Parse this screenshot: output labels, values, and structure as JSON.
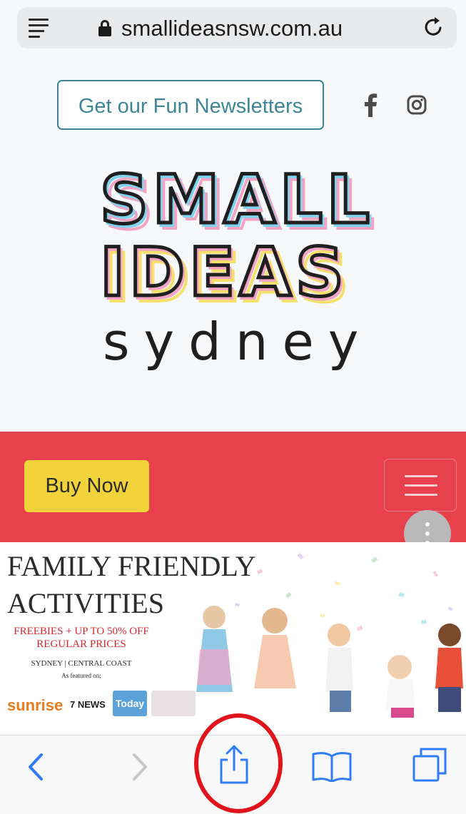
{
  "browser": {
    "url": "smallideasnsw.com.au",
    "icons": {
      "menu": "reader-icon",
      "lock": "lock-icon",
      "reload": "reload-icon"
    }
  },
  "header": {
    "newsletter_label": "Get our Fun Newsletters",
    "social": [
      "facebook-icon",
      "instagram-icon"
    ]
  },
  "logo": {
    "line1": "SMALL",
    "line2": "IDEAS",
    "line3": "sydney",
    "colors": {
      "yellow": "#f5e06a",
      "blue": "#7fd3ee",
      "pink": "#f3a3c4",
      "ink": "#1f1f1f"
    }
  },
  "nav": {
    "buy_label": "Buy Now",
    "menu_icon": "hamburger-icon",
    "accent": "#e8404d",
    "button_color": "#f2d33a"
  },
  "banner": {
    "title1": "FAMILY FRIENDLY",
    "title2": "ACTIVITIES",
    "offer1": "FREEBIES + UP TO 50% OFF",
    "offer2": "REGULAR PRICES",
    "location": "SYDNEY | CENTRAL COAST",
    "featured": "As featured on;",
    "sponsors": [
      "sunrise",
      "7 NEWS",
      "Today"
    ]
  },
  "toolbar": {
    "items": [
      "back-icon",
      "forward-icon",
      "share-icon",
      "bookmarks-icon",
      "tabs-icon"
    ]
  }
}
